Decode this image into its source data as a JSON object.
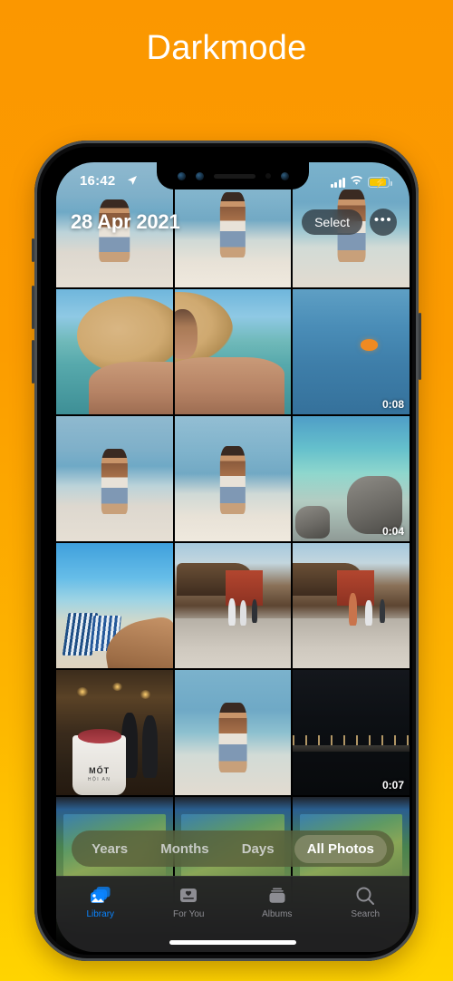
{
  "page": {
    "title": "Darkmode",
    "background_top": "#FB9700",
    "background_bottom": "#FFD400",
    "title_color": "#FFFFFF"
  },
  "status_bar": {
    "time": "16:42",
    "location_icon": "location-arrow-icon",
    "cellular_icon": "signal-bars-icon",
    "wifi_icon": "wifi-icon",
    "battery_icon": "battery-charging-icon",
    "battery_color": "#F7C600"
  },
  "notch": {
    "sensors": [
      "proximity-sensor",
      "ambient-light-sensor",
      "earpiece-speaker",
      "dot-projector",
      "front-camera"
    ]
  },
  "top_nav": {
    "date_title": "28 Apr 2021",
    "select_label": "Select",
    "more_label": "•••"
  },
  "photo_grid": {
    "columns": 3,
    "rows": [
      [
        {
          "name": "man-on-beach-1",
          "style": "beach-sky",
          "duration": null
        },
        {
          "name": "man-on-beach-2",
          "style": "beach-sky2",
          "duration": null
        },
        {
          "name": "man-on-beach-3",
          "style": "beach-sky3",
          "duration": null
        }
      ],
      [
        {
          "name": "straw-hat-selfie-left",
          "style": "hat-left",
          "duration": null
        },
        {
          "name": "straw-hat-selfie-right",
          "style": "hat-right",
          "duration": null
        },
        {
          "name": "snorkeler-in-sea-video",
          "style": "sea-deep",
          "duration": "0:08"
        }
      ],
      [
        {
          "name": "man-in-shallow-water-1",
          "style": "beach-sky",
          "duration": null
        },
        {
          "name": "man-in-shallow-water-2",
          "style": "beach-sky2",
          "duration": null
        },
        {
          "name": "rocky-lagoon-video",
          "style": "lagoon",
          "duration": "0:04"
        }
      ],
      [
        {
          "name": "beach-chairs-selfie",
          "style": "chairs",
          "duration": null
        },
        {
          "name": "hoi-an-bridge-1",
          "style": "bridge",
          "duration": null
        },
        {
          "name": "hoi-an-bridge-2",
          "style": "bridge",
          "duration": null
        }
      ],
      [
        {
          "name": "mot-hoi-an-drink",
          "style": "market",
          "duration": null,
          "cup_text": "MỐT",
          "cup_sub": "HỘI AN"
        },
        {
          "name": "man-on-beach-4",
          "style": "beach-sky3",
          "duration": null
        },
        {
          "name": "night-pier-video",
          "style": "night",
          "duration": "0:07"
        }
      ],
      [
        {
          "name": "map-screenshot-1",
          "style": "map-thumb",
          "duration": null
        },
        {
          "name": "map-screenshot-2",
          "style": "map-thumb",
          "duration": null
        },
        {
          "name": "map-screenshot-3",
          "style": "map-thumb",
          "duration": null
        }
      ]
    ]
  },
  "segmented_control": {
    "options": [
      {
        "label": "Years",
        "active": false
      },
      {
        "label": "Months",
        "active": false
      },
      {
        "label": "Days",
        "active": false
      },
      {
        "label": "All Photos",
        "active": true
      }
    ]
  },
  "tab_bar": {
    "active_color": "#0A84FF",
    "inactive_color": "#8D8D93",
    "tabs": [
      {
        "label": "Library",
        "icon": "photos-library-icon",
        "active": true
      },
      {
        "label": "For You",
        "icon": "for-you-icon",
        "active": false
      },
      {
        "label": "Albums",
        "icon": "albums-icon",
        "active": false
      },
      {
        "label": "Search",
        "icon": "search-icon",
        "active": false
      }
    ]
  }
}
